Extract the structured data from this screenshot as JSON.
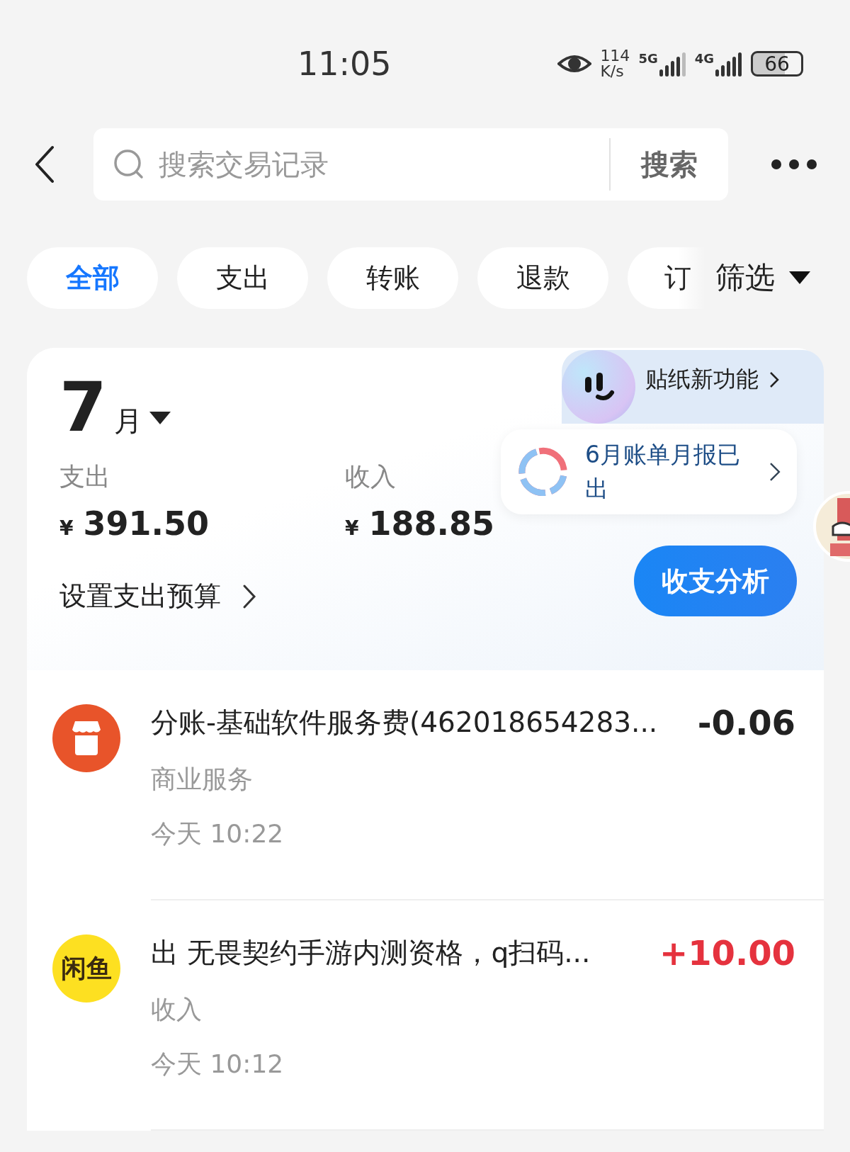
{
  "status_bar": {
    "time": "11:05",
    "net_speed": "114",
    "net_unit": "K/s",
    "signals": [
      {
        "label": "5G",
        "kind": "weak"
      },
      {
        "label": "4G",
        "kind": "full"
      }
    ],
    "battery": "66"
  },
  "header": {
    "search": {
      "placeholder": "搜索交易记录"
    },
    "search_button": "搜索"
  },
  "filters": [
    {
      "label": "全部",
      "selected": true
    },
    {
      "label": "支出",
      "selected": false
    },
    {
      "label": "转账",
      "selected": false
    },
    {
      "label": "退款",
      "selected": false
    },
    {
      "label": "订",
      "selected": false
    }
  ],
  "filter_button": "筛选",
  "summary": {
    "month": "7",
    "month_unit": "月",
    "expense_label": "支出",
    "expense_currency": "¥",
    "expense": "391.50",
    "income_label": "收入",
    "income_currency": "¥",
    "income": "188.85",
    "budget_link": "设置支出预算",
    "sticker_promo": "贴纸新功能",
    "report": "6月账单月报已出",
    "analysis_button": "收支分析"
  },
  "transactions": [
    {
      "kind": "store",
      "title": "分账-基础软件服务费(462018654283...",
      "amount": "-0.06",
      "color": "#222222",
      "category": "商业服务",
      "time": "今天 10:22"
    },
    {
      "kind": "logo",
      "logo": "闲鱼",
      "title": "出 无畏契约手游内测资格，q扫码...",
      "amount": "+10.00",
      "color": "#e5323e",
      "category": "收入",
      "time": "今天 10:12"
    }
  ]
}
